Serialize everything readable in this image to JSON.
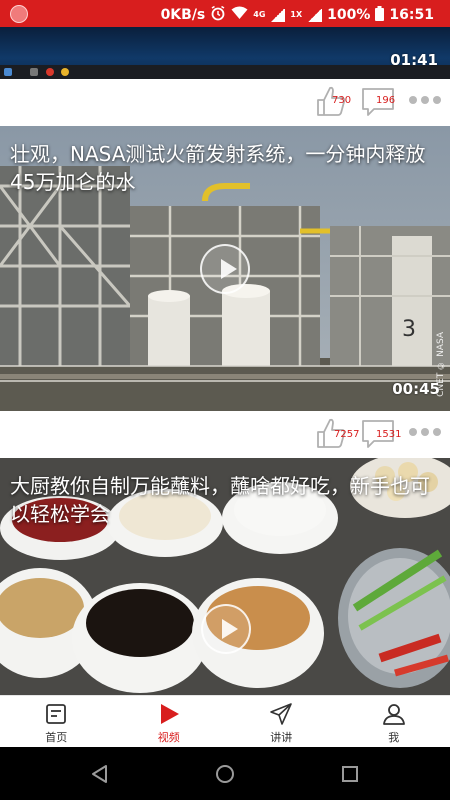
{
  "status_bar": {
    "network_speed": "0KB/s",
    "network_type": "4G",
    "roaming": "1X",
    "battery": "100%",
    "time": "16:51"
  },
  "feed": {
    "top_clip": {
      "duration": "01:41",
      "likes": "730",
      "comments": "196"
    },
    "videos": [
      {
        "title": "壮观，NASA测试火箭发射系统，一分钟内释放45万加仑的水",
        "duration": "00:45",
        "watermark": "CNET © NASA",
        "likes": "7257",
        "comments": "1531"
      },
      {
        "title": "大厨教你自制万能蘸料，蘸啥都好吃，新手也可以轻松学会"
      }
    ]
  },
  "tabbar": {
    "tabs": [
      {
        "label": "首页",
        "icon": "home-doc-icon"
      },
      {
        "label": "视频",
        "icon": "video-play-icon"
      },
      {
        "label": "讲讲",
        "icon": "paper-plane-icon"
      },
      {
        "label": "我",
        "icon": "user-icon"
      }
    ]
  },
  "colors": {
    "accent": "#d81e1e",
    "count_text": "#d81e1e",
    "inactive": "#333333"
  }
}
